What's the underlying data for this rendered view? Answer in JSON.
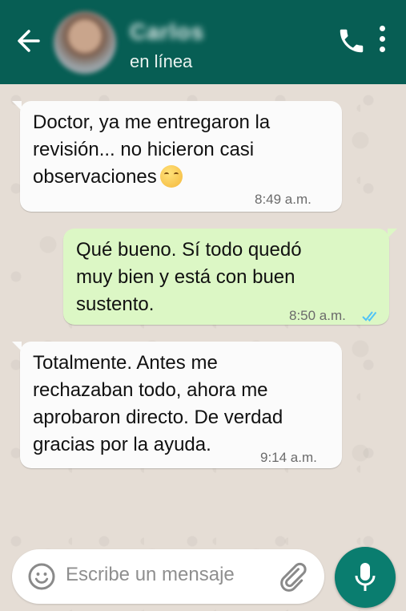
{
  "header": {
    "contact_name": "Carlos",
    "status": "en línea"
  },
  "messages": [
    {
      "direction": "incoming",
      "lines": [
        "Doctor, ya me entregaron la",
        "revisión... no hicieron casi",
        "observaciones"
      ],
      "time": "8:49 a.m."
    },
    {
      "direction": "outgoing",
      "lines": [
        "Qué bueno. Sí todo quedó",
        "muy bien y está con buen",
        "sustento."
      ],
      "time": "8:50 a.m."
    },
    {
      "direction": "incoming",
      "lines": [
        "Totalmente. Antes me",
        "rechazaban todo, ahora me",
        "aprobaron directo. De verdad",
        "gracias por la ayuda."
      ],
      "time": "9:14 a.m."
    }
  ],
  "input": {
    "placeholder": "Escribe un mensaje"
  },
  "colors": {
    "header": "#075e54",
    "incoming_bubble": "#fbfbfb",
    "outgoing_bubble": "#dcf7c5",
    "read_ticks": "#4fc3f7",
    "mic_button": "#0a7d6f"
  },
  "icons": [
    "back-arrow-icon",
    "phone-icon",
    "more-vert-icon",
    "emoji-icon",
    "attach-icon",
    "mic-icon",
    "double-check-icon"
  ]
}
